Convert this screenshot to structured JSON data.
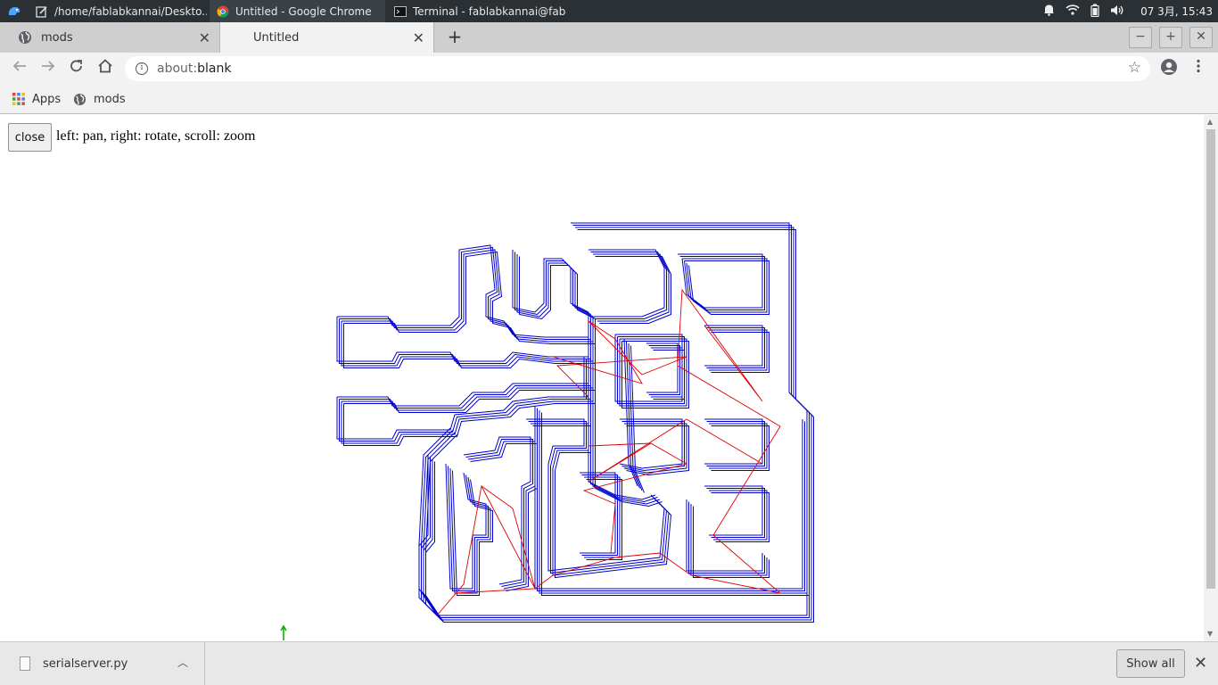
{
  "taskbar": {
    "tasks": [
      {
        "label": "/home/fablabkannai/Deskto..."
      },
      {
        "label": "Untitled - Google Chrome"
      },
      {
        "label": "Terminal - fablabkannai@fab..."
      }
    ],
    "clock": "07 3月, 15:43"
  },
  "tabs": [
    {
      "label": "mods"
    },
    {
      "label": "Untitled"
    }
  ],
  "toolbar": {
    "url_scheme": "about:",
    "url_rest": "blank"
  },
  "bookmarks": [
    {
      "label": "Apps"
    },
    {
      "label": "mods"
    }
  ],
  "page": {
    "close_label": "close",
    "hint": "left: pan, right: rotate, scroll: zoom"
  },
  "downloads": {
    "file": "serialserver.py",
    "show_all": "Show all"
  },
  "colors": {
    "toolpath": "#0000cc",
    "moves": "#dd0000",
    "origin_axis": "#00aa00"
  }
}
